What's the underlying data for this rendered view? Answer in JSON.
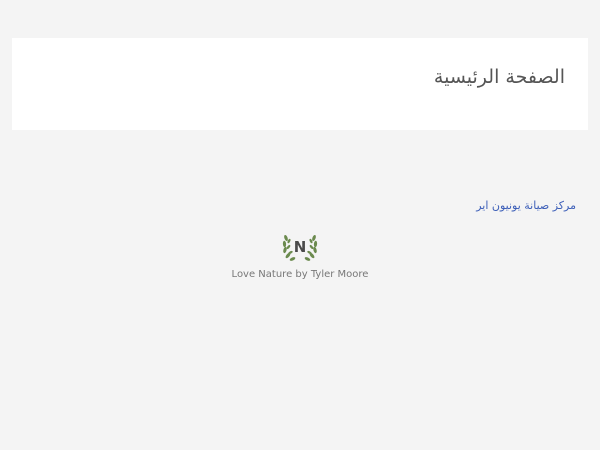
{
  "header": {
    "title": "الصفحة الرئيسية"
  },
  "main": {
    "link_text": "مركز صيانة يونيون اير"
  },
  "footer": {
    "logo_letter": "N",
    "logo_icon": "laurel-wreath-icon",
    "credit_prefix": "Love Nature by ",
    "credit_author": "Tyler Moore"
  },
  "colors": {
    "background": "#f4f4f4",
    "card": "#ffffff",
    "link": "#3d5fb8",
    "logo_green": "#6b8a4e",
    "text_muted": "#777777"
  }
}
